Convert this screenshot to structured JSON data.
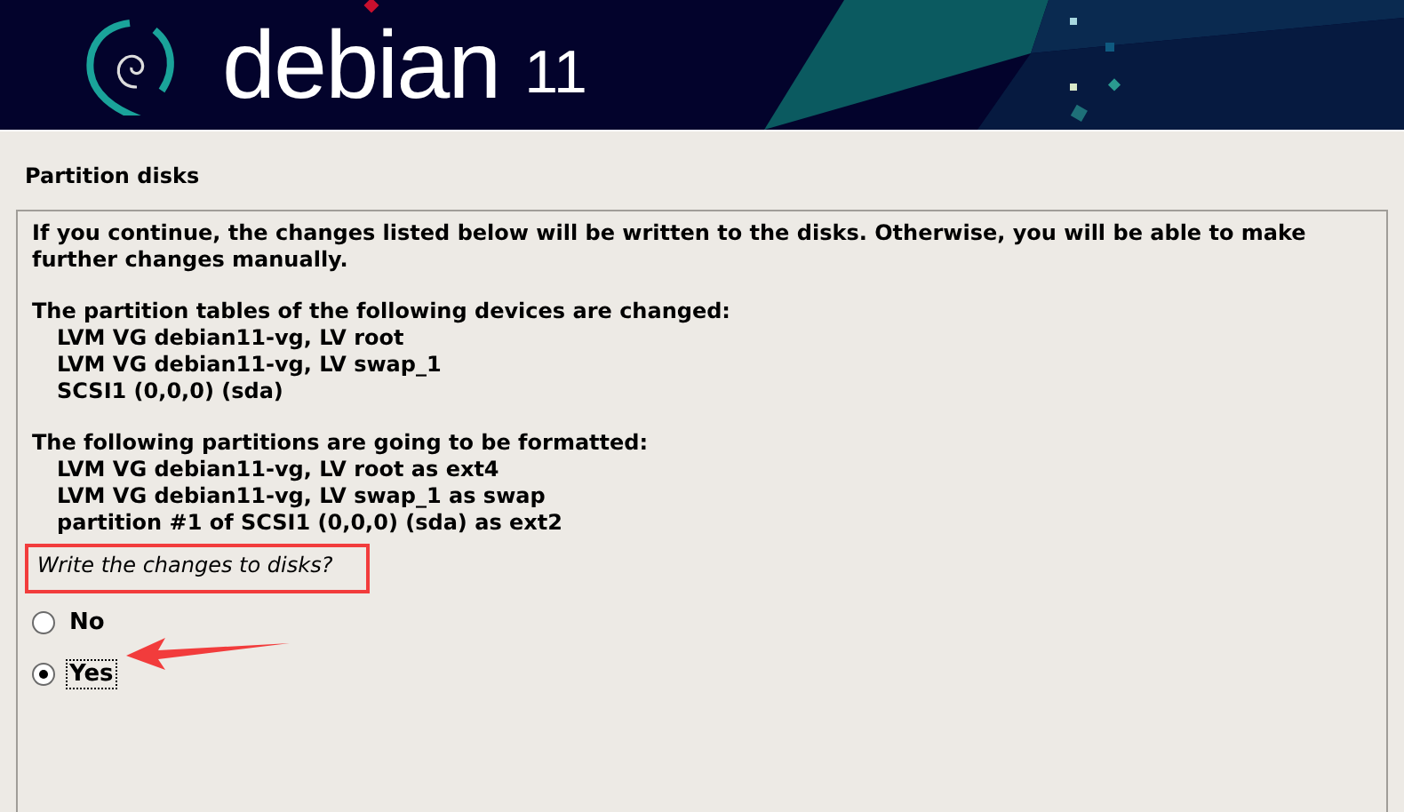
{
  "header": {
    "logo_text": "debian",
    "version": "11"
  },
  "title": "Partition disks",
  "intro": "If you continue, the changes listed below will be written to the disks. Otherwise, you will be able to make further changes manually.",
  "sections": [
    {
      "heading": "The partition tables of the following devices are changed:",
      "items": [
        "LVM VG debian11-vg, LV root",
        "LVM VG debian11-vg, LV swap_1",
        "SCSI1 (0,0,0) (sda)"
      ]
    },
    {
      "heading": "The following partitions are going to be formatted:",
      "items": [
        "LVM VG debian11-vg, LV root as ext4",
        "LVM VG debian11-vg, LV swap_1 as swap",
        "partition #1 of SCSI1 (0,0,0) (sda) as ext2"
      ]
    }
  ],
  "question": "Write the changes to disks?",
  "options": [
    {
      "label": "No",
      "selected": false,
      "focused": false
    },
    {
      "label": "Yes",
      "selected": true,
      "focused": true
    }
  ]
}
